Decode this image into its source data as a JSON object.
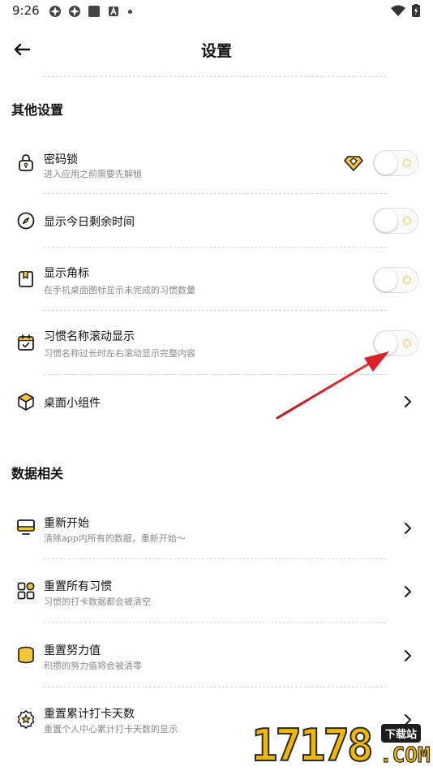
{
  "status_bar": {
    "time": "9:26",
    "icons": [
      "app-notification-icon",
      "app-notification-icon",
      "square-app-icon",
      "font-app-icon",
      "dot-icon"
    ],
    "right_icons": [
      "wifi-icon",
      "battery-charging-icon"
    ]
  },
  "header": {
    "title": "设置",
    "back_icon": "arrow-left-icon"
  },
  "sections": {
    "other": {
      "title": "其他设置"
    },
    "data": {
      "title": "数据相关"
    }
  },
  "rows": {
    "password_lock": {
      "title": "密码锁",
      "subtitle": "进入应用之前需要先解锁",
      "icon": "lock-icon",
      "badge_icon": "diamond-icon",
      "toggle_on": false
    },
    "remaining_time": {
      "title": "显示今日剩余时间",
      "icon": "compass-icon",
      "toggle_on": false
    },
    "badge": {
      "title": "显示角标",
      "subtitle": "在手机桌面图标显示未完成的习惯数量",
      "icon": "bookmark-icon",
      "toggle_on": false
    },
    "scroll_name": {
      "title": "习惯名称滚动显示",
      "subtitle": "习惯名称过长时左右滚动显示完整内容",
      "icon": "calendar-check-icon",
      "toggle_on": false
    },
    "widget": {
      "title": "桌面小组件",
      "icon": "cube-icon"
    },
    "restart": {
      "title": "重新开始",
      "subtitle": "清除app内所有的数据，重新开始～",
      "icon": "monitor-icon"
    },
    "reset_habits": {
      "title": "重置所有习惯",
      "subtitle": "习惯的打卡数据都会被清空",
      "icon": "grid-icon"
    },
    "reset_effort": {
      "title": "重置努力值",
      "subtitle": "积攒的努力值将会被清零",
      "icon": "coins-icon"
    },
    "reset_days": {
      "title": "重置累计打卡天数",
      "subtitle": "重置个人中心累计打卡天数的显示",
      "icon": "star-badge-icon"
    }
  },
  "colors": {
    "accent": "#f2c43b",
    "annotation_arrow": "#d9232a",
    "text_primary": "#111111",
    "text_secondary": "#8a8a8a"
  },
  "watermark": {
    "digits": "17178",
    "badge": "下载站",
    "suffix": ".COM"
  }
}
